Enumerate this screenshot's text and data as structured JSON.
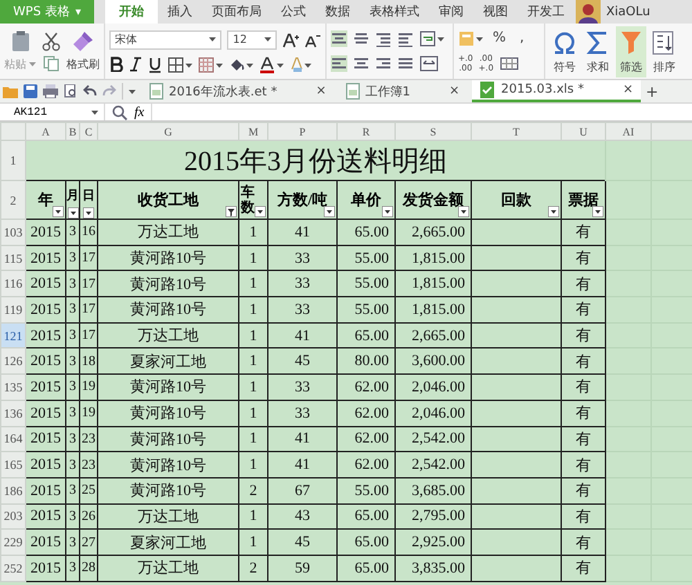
{
  "app_menu": {
    "label": "WPS 表格",
    "caret": "▾"
  },
  "ribbon_tabs": [
    {
      "label": "开始",
      "selected": true
    },
    {
      "label": "插入",
      "selected": false
    },
    {
      "label": "页面布局",
      "selected": false
    },
    {
      "label": "公式",
      "selected": false
    },
    {
      "label": "数据",
      "selected": false
    },
    {
      "label": "表格样式",
      "selected": false
    },
    {
      "label": "审阅",
      "selected": false
    },
    {
      "label": "视图",
      "selected": false
    },
    {
      "label": "开发工",
      "selected": false
    }
  ],
  "user": {
    "name": "XiaOLu"
  },
  "ribbon": {
    "paste": "粘贴",
    "format_painter": "格式刷",
    "font_name": "宋体",
    "font_size": "12",
    "percent": "%",
    "comma": ",",
    "decimals": [
      {
        "top": "+.0",
        "bottom": ".00"
      },
      {
        "top": ".00",
        "bottom": "+.0"
      }
    ],
    "tools": [
      {
        "label": "符号",
        "kind": "symbol",
        "selected": false
      },
      {
        "label": "求和",
        "kind": "sum",
        "selected": false
      },
      {
        "label": "筛选",
        "kind": "filter",
        "selected": true
      },
      {
        "label": "排序",
        "kind": "sort",
        "selected": false
      }
    ]
  },
  "doc_tabs": [
    {
      "label": "2016年流水表.et *",
      "close": "×",
      "selected": false
    },
    {
      "label": "工作簿1",
      "close": "×",
      "selected": false
    },
    {
      "label": "2015.03.xls *",
      "close": "×",
      "selected": true
    }
  ],
  "new_tab": "+",
  "formula_bar": {
    "name_box": "AK121",
    "fx": "fx"
  },
  "sheet": {
    "columns": [
      "A",
      "B",
      "C",
      "G",
      "M",
      "P",
      "R",
      "S",
      "T",
      "U",
      "AI"
    ],
    "title_row_number": "1",
    "title": "2015年3月份送料明细",
    "header_row_number": "2",
    "headers": [
      {
        "label": "年",
        "filtered": false
      },
      {
        "label": "月",
        "filtered": false
      },
      {
        "label": "日",
        "filtered": false
      },
      {
        "label": "收货工地",
        "filtered": true
      },
      {
        "label": "车数",
        "filtered": false
      },
      {
        "label": "方数/吨",
        "filtered": false
      },
      {
        "label": "单价",
        "filtered": false
      },
      {
        "label": "发货金额",
        "filtered": false
      },
      {
        "label": "回款",
        "filtered": false
      },
      {
        "label": "票据",
        "filtered": false
      }
    ],
    "rows": [
      {
        "number": "103",
        "selected": false,
        "year": "2015",
        "month": "3",
        "day": "16",
        "site": "万达工地",
        "trucks": "1",
        "tons": "41",
        "price": "65.00",
        "amount": "2,665.00",
        "invoice": "有"
      },
      {
        "number": "115",
        "selected": false,
        "year": "2015",
        "month": "3",
        "day": "17",
        "site": "黄河路10号",
        "trucks": "1",
        "tons": "33",
        "price": "55.00",
        "amount": "1,815.00",
        "invoice": "有"
      },
      {
        "number": "116",
        "selected": false,
        "year": "2015",
        "month": "3",
        "day": "17",
        "site": "黄河路10号",
        "trucks": "1",
        "tons": "33",
        "price": "55.00",
        "amount": "1,815.00",
        "invoice": "有"
      },
      {
        "number": "119",
        "selected": false,
        "year": "2015",
        "month": "3",
        "day": "17",
        "site": "黄河路10号",
        "trucks": "1",
        "tons": "33",
        "price": "55.00",
        "amount": "1,815.00",
        "invoice": "有"
      },
      {
        "number": "121",
        "selected": true,
        "year": "2015",
        "month": "3",
        "day": "17",
        "site": "万达工地",
        "trucks": "1",
        "tons": "41",
        "price": "65.00",
        "amount": "2,665.00",
        "invoice": "有"
      },
      {
        "number": "126",
        "selected": false,
        "year": "2015",
        "month": "3",
        "day": "18",
        "site": "夏家河工地",
        "trucks": "1",
        "tons": "45",
        "price": "80.00",
        "amount": "3,600.00",
        "invoice": "有"
      },
      {
        "number": "135",
        "selected": false,
        "year": "2015",
        "month": "3",
        "day": "19",
        "site": "黄河路10号",
        "trucks": "1",
        "tons": "33",
        "price": "62.00",
        "amount": "2,046.00",
        "invoice": "有"
      },
      {
        "number": "136",
        "selected": false,
        "year": "2015",
        "month": "3",
        "day": "19",
        "site": "黄河路10号",
        "trucks": "1",
        "tons": "33",
        "price": "62.00",
        "amount": "2,046.00",
        "invoice": "有"
      },
      {
        "number": "164",
        "selected": false,
        "year": "2015",
        "month": "3",
        "day": "23",
        "site": "黄河路10号",
        "trucks": "1",
        "tons": "41",
        "price": "62.00",
        "amount": "2,542.00",
        "invoice": "有"
      },
      {
        "number": "165",
        "selected": false,
        "year": "2015",
        "month": "3",
        "day": "23",
        "site": "黄河路10号",
        "trucks": "1",
        "tons": "41",
        "price": "62.00",
        "amount": "2,542.00",
        "invoice": "有"
      },
      {
        "number": "186",
        "selected": false,
        "year": "2015",
        "month": "3",
        "day": "25",
        "site": "黄河路10号",
        "trucks": "2",
        "tons": "67",
        "price": "55.00",
        "amount": "3,685.00",
        "invoice": "有"
      },
      {
        "number": "203",
        "selected": false,
        "year": "2015",
        "month": "3",
        "day": "26",
        "site": "万达工地",
        "trucks": "1",
        "tons": "43",
        "price": "65.00",
        "amount": "2,795.00",
        "invoice": "有"
      },
      {
        "number": "229",
        "selected": false,
        "year": "2015",
        "month": "3",
        "day": "27",
        "site": "夏家河工地",
        "trucks": "1",
        "tons": "45",
        "price": "65.00",
        "amount": "2,925.00",
        "invoice": "有"
      },
      {
        "number": "252",
        "selected": false,
        "year": "2015",
        "month": "3",
        "day": "28",
        "site": "万达工地",
        "trucks": "2",
        "tons": "59",
        "price": "65.00",
        "amount": "3,835.00",
        "invoice": "有"
      }
    ]
  }
}
